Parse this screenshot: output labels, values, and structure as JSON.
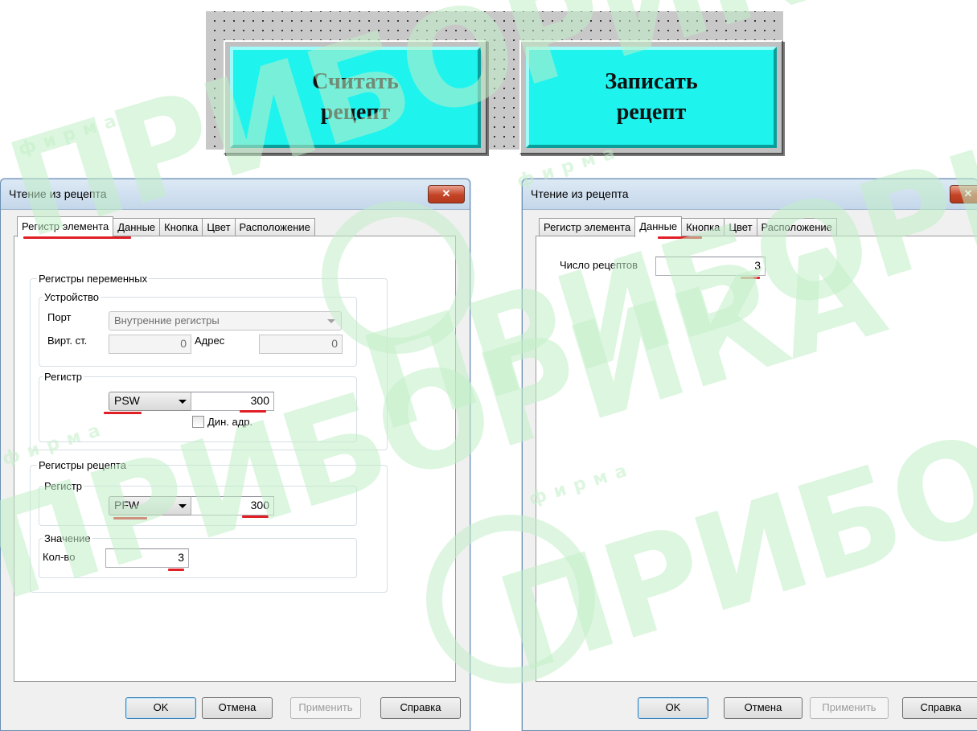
{
  "canvas": {
    "buttons": [
      {
        "label": "Считать\nрецепт"
      },
      {
        "label": "Записать\nрецепт"
      }
    ]
  },
  "dialog": {
    "title": "Чтение из рецепта",
    "close_symbol": "✕",
    "tabs": [
      "Регистр элемента",
      "Данные",
      "Кнопка",
      "Цвет",
      "Расположение"
    ],
    "buttons": {
      "ok": "OK",
      "cancel": "Отмена",
      "apply": "Применить",
      "help": "Справка"
    }
  },
  "left_dialog": {
    "active_tab": "Регистр элемента",
    "variable_registers": {
      "title": "Регистры переменных",
      "device": {
        "title": "Устройство",
        "port_label": "Порт",
        "port_value": "Внутренние регистры",
        "virt_label": "Вирт. ст.",
        "virt_value": "0",
        "addr_label": "Адрес",
        "addr_value": "0"
      },
      "register": {
        "title": "Регистр",
        "type": "PSW",
        "value": "300",
        "dyn_label": "Дин. адр."
      }
    },
    "recipe_registers": {
      "title": "Регистры рецепта",
      "register": {
        "title": "Регистр",
        "type": "PFW",
        "value": "300"
      },
      "value_group": {
        "title": "Значение",
        "count_label": "Кол-во",
        "count_value": "3"
      }
    }
  },
  "right_dialog": {
    "active_tab": "Данные",
    "recipes_label": "Число рецептов",
    "recipes_value": "3"
  },
  "watermark": {
    "text": "ПРИБОРИКА",
    "small_text": "фирма"
  },
  "colors": {
    "button_face": "#1ff3ee",
    "highlight_line": "#e01e25",
    "watermark": "#c2efc8"
  }
}
